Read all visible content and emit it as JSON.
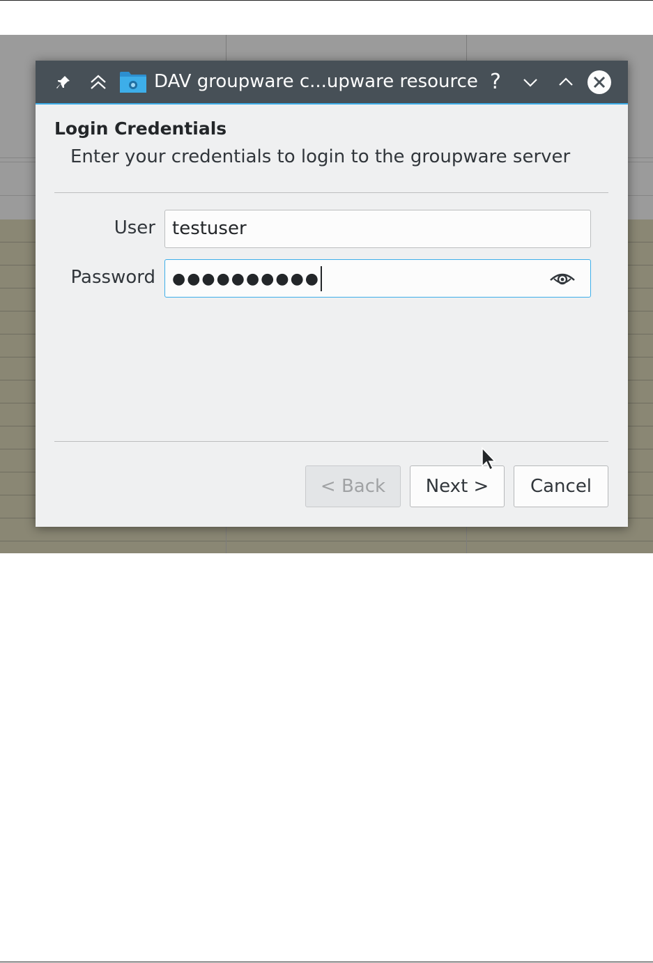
{
  "dialog": {
    "title": "DAV groupware c...upware resource",
    "titlebar_icons": [
      "pin-icon",
      "keep-above-icon",
      "folder-globe-icon"
    ],
    "titlebar_buttons": [
      "help-button",
      "minimize-button",
      "maximize-button",
      "close-button"
    ],
    "help_glyph": "?",
    "heading": "Login Credentials",
    "subheading": "Enter your credentials to login to the groupware server"
  },
  "form": {
    "user_label": "User",
    "user_value": "testuser",
    "password_label": "Password",
    "password_value": "●●●●●●●●●●",
    "password_toggle_icon": "eye-icon"
  },
  "buttons": {
    "back": "< Back",
    "back_enabled": false,
    "next": "Next >",
    "cancel": "Cancel"
  },
  "colors": {
    "titlebar": "#475057",
    "accent": "#3daee9",
    "dialog_bg": "#eff0f1"
  }
}
